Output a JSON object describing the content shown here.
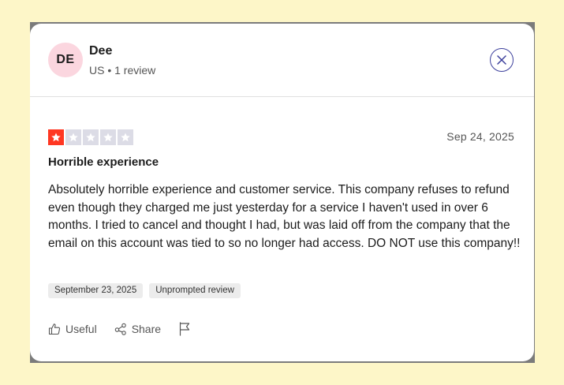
{
  "reviewer": {
    "initials": "DE",
    "name": "Dee",
    "meta": "US • 1 review"
  },
  "review": {
    "rating": 1,
    "max_rating": 5,
    "date": "Sep 24, 2025",
    "title": "Horrible experience",
    "body": "Absolutely horrible experience and customer service. This company refuses to refund even though they charged me just yesterday for a service I haven't used in over 6 months. I tried to cancel and thought I had, but was laid off from the company that the email on this account was tied to so no longer had access. DO NOT use this company!!",
    "tags": [
      "September 23, 2025",
      "Unprompted review"
    ]
  },
  "actions": {
    "useful_label": "Useful",
    "share_label": "Share"
  },
  "icons": {
    "close": "close-icon",
    "useful": "thumbs-up-icon",
    "share": "share-icon",
    "report": "flag-icon",
    "star": "star-icon"
  },
  "colors": {
    "star_filled": "#ff3722",
    "star_empty": "#dcdce6",
    "avatar_bg": "#fbd6df",
    "close_accent": "#3c3f9c",
    "page_bg": "#fdf6c8"
  }
}
